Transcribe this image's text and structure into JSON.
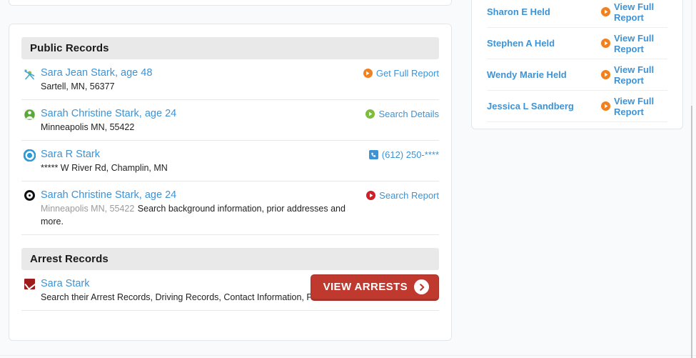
{
  "theme": {
    "page_bg": "#f8fafc",
    "card_bg": "#ffffff",
    "link_blue": "#3e93d4",
    "section_header_bg": "#e9e9e9",
    "orange": "#f2801e",
    "green": "#7cbd3f",
    "red": "#cf2027",
    "button_red": "#c0392f",
    "arrest_icon_red": "#9e1b1b"
  },
  "sections": [
    {
      "id": "public-records",
      "title": "Public Records",
      "rows": [
        {
          "icon": "person-star-icon",
          "name": "Sara Jean Stark, age 48",
          "location": "Sartell, MN, 56377",
          "location_muted": false,
          "sub": "",
          "action_label": "Get Full Report",
          "action_icon": "play-circle-orange-icon"
        },
        {
          "icon": "person-avatar-green-icon",
          "name": "Sarah Christine Stark, age 24",
          "location": "Minneapolis MN, 55422",
          "location_muted": false,
          "sub": "",
          "action_label": "Search Details",
          "action_icon": "play-circle-green-icon"
        },
        {
          "icon": "person-circle-blue-icon",
          "name": "Sara R Stark",
          "location": "***** W River Rd, Champlin, MN",
          "location_muted": false,
          "sub": "",
          "action_label": "(612) 250-****",
          "action_icon": "phone-icon"
        },
        {
          "icon": "target-circle-icon",
          "name": "Sarah Christine Stark, age 24",
          "location": "Minneapolis MN, 55422",
          "location_muted": true,
          "sub": "Search background information, prior addresses and more.",
          "action_label": "Search Report",
          "action_icon": "play-circle-red-icon"
        }
      ]
    },
    {
      "id": "arrest-records",
      "title": "Arrest Records",
      "rows": [
        {
          "icon": "arrest-badge-icon",
          "name": "Sara Stark",
          "location": "",
          "location_muted": false,
          "sub": "Search their Arrest Records, Driving Records, Contact Information, Photos and More...",
          "action_label": "",
          "action_icon": ""
        }
      ],
      "button": {
        "label": "VIEW ARRESTS",
        "icon": "chevron-right-circle-icon"
      }
    }
  ],
  "sidebar": {
    "rows": [
      {
        "name": "Sharon E Held",
        "action_label": "View Full Report",
        "action_icon": "play-circle-orange-icon"
      },
      {
        "name": "Stephen A Held",
        "action_label": "View Full Report",
        "action_icon": "play-circle-orange-icon"
      },
      {
        "name": "Wendy Marie Held",
        "action_label": "View Full Report",
        "action_icon": "play-circle-orange-icon"
      },
      {
        "name": "Jessica L Sandberg",
        "action_label": "View Full Report",
        "action_icon": "play-circle-orange-icon"
      }
    ]
  }
}
